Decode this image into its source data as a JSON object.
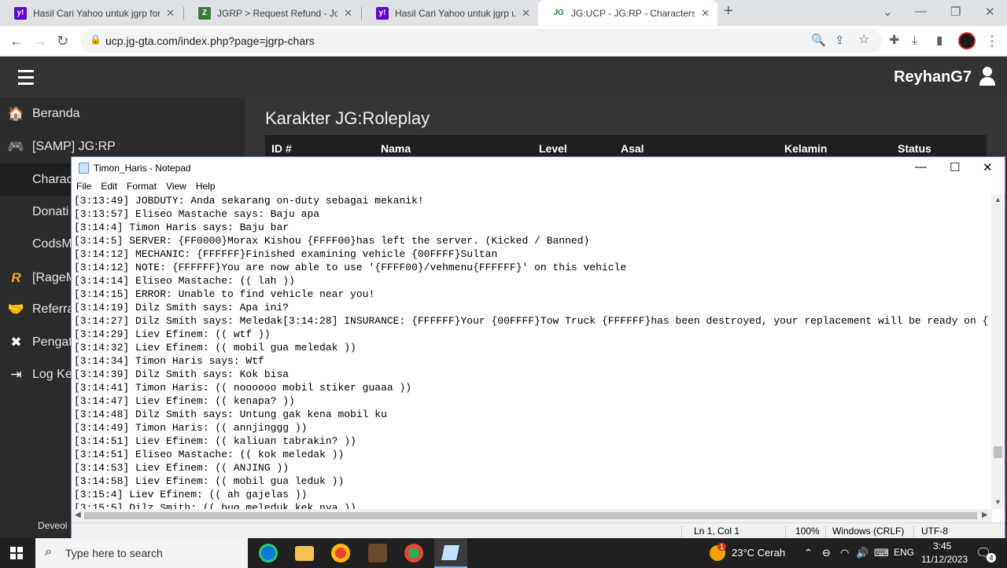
{
  "browser": {
    "tabs": [
      {
        "label": "Hasil Cari Yahoo untuk jgrp foru",
        "favicon": "yahoo-icon",
        "active": false
      },
      {
        "label": "JGRP > Request Refund - Jogjag",
        "favicon": "jgrp-forum-icon",
        "active": false
      },
      {
        "label": "Hasil Cari Yahoo untuk jgrp ucp",
        "favicon": "yahoo-icon",
        "active": false
      },
      {
        "label": "JG:UCP - JG:RP - Characters",
        "favicon": "jg-icon",
        "active": true
      }
    ],
    "favicon_text": {
      "yahoo": "y!",
      "jgrp": "Z",
      "jg": "JG"
    },
    "close_glyph": "✕",
    "new_tab_glyph": "+",
    "url": "ucp.jg-gta.com/index.php?page=jgrp-chars",
    "colors": {
      "tabstrip": "#dee1e6",
      "yahoo": "#6001d2",
      "jgrp": "#3a7a3a"
    }
  },
  "ucp": {
    "username": "ReyhanG7",
    "sidebar": [
      {
        "label": "Beranda",
        "icon": "home-icon",
        "glyph": "🏠"
      },
      {
        "label": "[SAMP] JG:RP",
        "icon": "samp-icon",
        "glyph": "🎮"
      },
      {
        "label": "Charac",
        "icon": "",
        "glyph": ""
      },
      {
        "label": "Donati",
        "icon": "",
        "glyph": ""
      },
      {
        "label": "CodsM",
        "icon": "",
        "glyph": ""
      },
      {
        "label": "[RageM",
        "icon": "rage-icon",
        "glyph": "R"
      },
      {
        "label": "Referra",
        "icon": "handshake-icon",
        "glyph": "🤝"
      },
      {
        "label": "Pengat",
        "icon": "tools-icon",
        "glyph": "✖"
      },
      {
        "label": "Log Ke",
        "icon": "logout-icon",
        "glyph": "⇥"
      }
    ],
    "footer": "Deveol",
    "page_title": "Karakter JG:Roleplay",
    "table_headers": [
      "ID #",
      "Nama",
      "Level",
      "Asal",
      "Kelamin",
      "Status"
    ]
  },
  "notepad": {
    "title": "Timon_Haris - Notepad",
    "menu": [
      "File",
      "Edit",
      "Format",
      "View",
      "Help"
    ],
    "lines": [
      "[3:13:49] JOBDUTY: Anda sekarang on-duty sebagai mekanik!",
      "[3:13:57] Eliseo Mastache says: Baju apa",
      "[3:14:4] Timon Haris says: Baju bar",
      "[3:14:5] SERVER: {FF0000}Morax Kishou {FFFF00}has left the server. (Kicked / Banned)",
      "[3:14:12] MECHANIC: {FFFFFF}Finished examining vehicle {00FFFF}Sultan",
      "[3:14:12] NOTE: {FFFFFF}You are now able to use '{FFFF00}/vehmenu{FFFFFF}' on this vehicle",
      "[3:14:14] Eliseo Mastache: (( lah ))",
      "[3:14:15] ERROR: Unable to find vehicle near you!",
      "[3:14:19] Dilz Smith says: Apa ini?",
      "[3:14:27] Dilz Smith says: Meledak[3:14:28] INSURANCE: {FFFFFF}Your {00FFFF}Tow Truck {FFFFFF}has been destroyed, your replacement will be ready on {FFFF00",
      "[3:14:29] Liev Efinem: (( wtf ))",
      "[3:14:32] Liev Efinem: (( mobil gua meledak ))",
      "[3:14:34] Timon Haris says: Wtf",
      "[3:14:39] Dilz Smith says: Kok bisa",
      "[3:14:41] Timon Haris: (( noooooo mobil stiker guaaa ))",
      "[3:14:47] Liev Efinem: (( kenapa? ))",
      "[3:14:48] Dilz Smith says: Untung gak kena mobil ku",
      "[3:14:49] Timon Haris: (( annjinggg ))",
      "[3:14:51] Liev Efinem: (( kaliuan tabrakin? ))",
      "[3:14:51] Eliseo Mastache: (( kok meledak ))",
      "[3:14:53] Liev Efinem: (( ANJING ))",
      "[3:14:58] Liev Efinem: (( mobil gua leduk ))",
      "[3:15:4] Liev Efinem: (( ah gajelas ))",
      "[3:15:5] Dilz Smith: (( bug meleduk kek nya ))"
    ],
    "status": {
      "position": "Ln 1, Col 1",
      "zoom": "100%",
      "eol": "Windows (CRLF)",
      "encoding": "UTF-8"
    },
    "controls": {
      "min": "—",
      "max": "☐",
      "close": "✕"
    }
  },
  "taskbar": {
    "search_placeholder": "Type here to search",
    "weather": "23°C  Cerah",
    "language": "ENG",
    "time": "3:45",
    "date": "11/12/2023",
    "notification_count": "4",
    "weather_badge": "1"
  }
}
